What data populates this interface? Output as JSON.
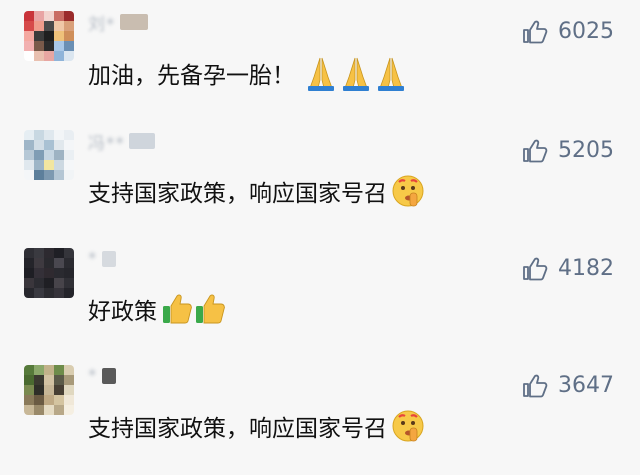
{
  "comments": [
    {
      "username": "刘*",
      "text": "加油，先备孕一胎！",
      "emoji": "pray-hands",
      "emoji_count": 3,
      "likes": "6025",
      "avatar_colors": [
        "#c9343a",
        "#e8a4a4",
        "#f2d4cf",
        "#c96c63",
        "#9a2b2b",
        "#d64a4a",
        "#ef9c8c",
        "#4a4a4a",
        "#f0c8a8",
        "#d9a07a",
        "#f4a8a0",
        "#3b3b3b",
        "#1f1f1f",
        "#efc27a",
        "#cf8f5a",
        "#f2b0b0",
        "#7a5a4a",
        "#2b2b2b",
        "#a9c8e8",
        "#6a8fb4",
        "#ffffff",
        "#e9c0b0",
        "#e7a6a2",
        "#8fb4d9",
        "#dbe6f0"
      ]
    },
    {
      "username": "冯**",
      "text": "支持国家政策，响应国家号召",
      "emoji": "shushing-face",
      "emoji_count": 1,
      "likes": "5205",
      "avatar_colors": [
        "#e6eef3",
        "#c8d8e2",
        "#dfe8ee",
        "#f2f5f7",
        "#e9eef2",
        "#9fb6c8",
        "#d1dde6",
        "#a9c1d3",
        "#e1e8ed",
        "#f4f6f8",
        "#b6c8d6",
        "#7f9db5",
        "#c6d6e2",
        "#9eb3c3",
        "#eaeff3",
        "#e0e8ee",
        "#9db5c7",
        "#f2e6a0",
        "#cdd9e2",
        "#f5f7f9",
        "#f4f6f8",
        "#5d7f9b",
        "#7d99b0",
        "#b4c6d4",
        "#f1f4f6"
      ]
    },
    {
      "username": "*",
      "text": "好政策",
      "emoji": "thumbs-up",
      "emoji_count": 2,
      "likes": "4182",
      "avatar_colors": [
        "#2f2f35",
        "#3a3a40",
        "#2d2a30",
        "#1f1f25",
        "#35353b",
        "#24242a",
        "#3e3a40",
        "#2a2a2f",
        "#4a4850",
        "#2b2b31",
        "#1e1e24",
        "#343038",
        "#2f2a30",
        "#2a2a30",
        "#26262c",
        "#3a363c",
        "#2c2c32",
        "#1f1f24",
        "#47444a",
        "#303036",
        "#27272d",
        "#393940",
        "#2b2b30",
        "#35333a",
        "#24242a"
      ]
    },
    {
      "username": "*",
      "text": "支持国家政策，响应国家号召",
      "emoji": "shushing-face",
      "emoji_count": 1,
      "likes": "3647",
      "avatar_colors": [
        "#567a3a",
        "#8ba86a",
        "#c2b28a",
        "#6e8c4a",
        "#d9cdb0",
        "#4a6a30",
        "#3b3a30",
        "#d2c2a2",
        "#5b5a48",
        "#a89a7a",
        "#7a8a50",
        "#2e2e28",
        "#c6b696",
        "#473f33",
        "#e0d8c0",
        "#8a7a5a",
        "#6a5a42",
        "#bfa984",
        "#d4c4a0",
        "#f0e8d8",
        "#c8b898",
        "#9a8a6a",
        "#e6dcc4",
        "#b8a888",
        "#f5efe2"
      ]
    }
  ]
}
